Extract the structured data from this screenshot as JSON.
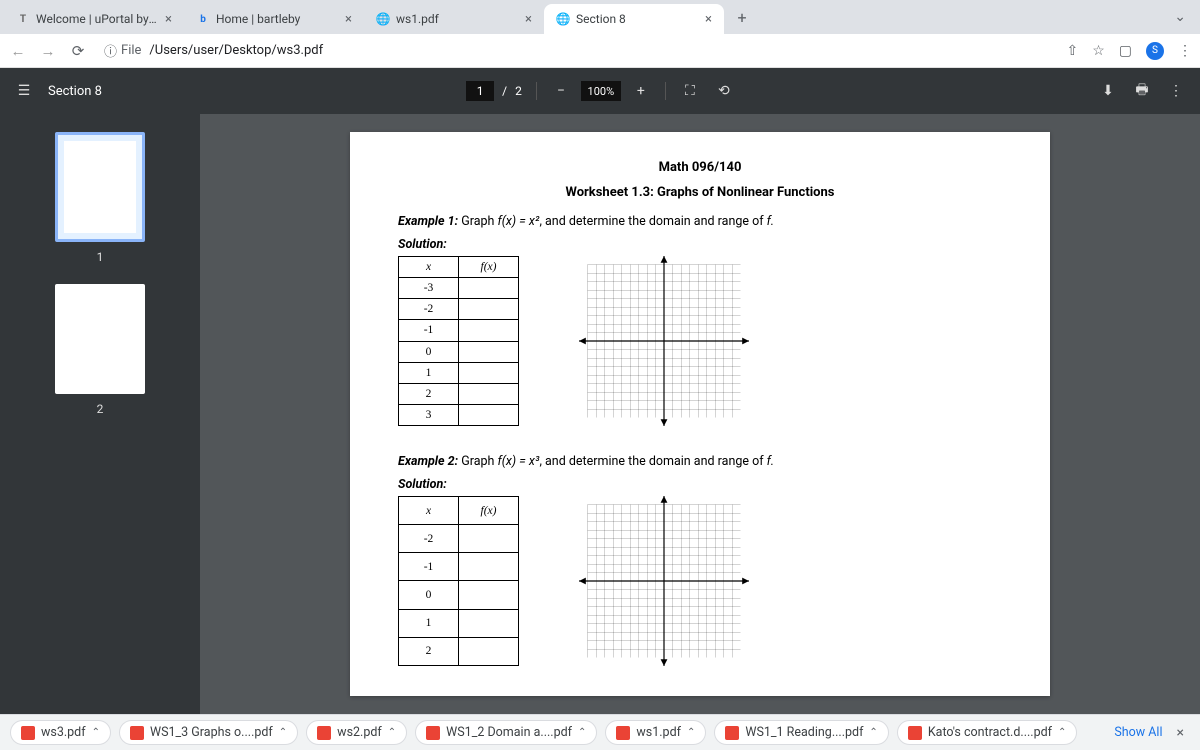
{
  "tabs": [
    {
      "label": "Welcome | uPortal by Apereo",
      "favicon": "T"
    },
    {
      "label": "Home | bartleby",
      "favicon": "b"
    },
    {
      "label": "ws1.pdf",
      "favicon": "⬤"
    },
    {
      "label": "Section 8",
      "favicon": "⬤",
      "active": true
    }
  ],
  "url": {
    "proto_label": "File",
    "path": "/Users/user/Desktop/ws3.pdf"
  },
  "pdf": {
    "title": "Section 8",
    "page_current": "1",
    "page_total": "2",
    "zoom": "100%"
  },
  "thumbs": [
    "1",
    "2"
  ],
  "document": {
    "course": "Math 096/140",
    "worksheet": "Worksheet 1.3: Graphs of Nonlinear Functions",
    "ex1_prefix": "Example 1:",
    "ex1_body_a": "Graph ",
    "ex1_func": "f(x) = x²",
    "ex1_body_b": ", and determine the domain and range of ",
    "ex1_fend": "f.",
    "solution_label": "Solution:",
    "table_head_x": "x",
    "table_head_fx": "f(x)",
    "ex1_xs": [
      "-3",
      "-2",
      "-1",
      "0",
      "1",
      "2",
      "3"
    ],
    "ex2_prefix": "Example 2:",
    "ex2_body_a": "Graph ",
    "ex2_func": "f(x) = x³",
    "ex2_body_b": ", and determine the domain and range of ",
    "ex2_fend": "f.",
    "ex2_xs": [
      "-2",
      "-1",
      "0",
      "1",
      "2"
    ]
  },
  "downloads": [
    {
      "name": "ws3.pdf"
    },
    {
      "name": "WS1_3 Graphs o....pdf"
    },
    {
      "name": "ws2.pdf"
    },
    {
      "name": "WS1_2 Domain a....pdf"
    },
    {
      "name": "ws1.pdf"
    },
    {
      "name": "WS1_1 Reading....pdf"
    },
    {
      "name": "Kato's contract.d....pdf"
    }
  ],
  "showall": "Show All",
  "avatar": "S"
}
